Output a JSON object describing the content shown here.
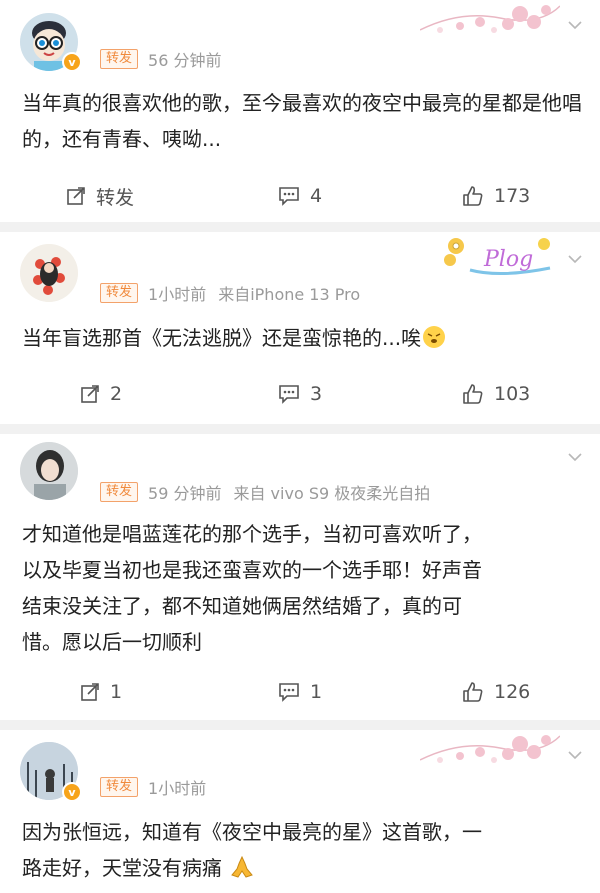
{
  "comments": [
    {
      "badge": "转发",
      "time": "56 分钟前",
      "source": "",
      "text": "当年真的很喜欢他的歌，至今最喜欢的夜空中最亮的星都是他唱的，还有青春、咦呦...",
      "actions": {
        "repost": "转发",
        "comment": "4",
        "like": "173"
      }
    },
    {
      "badge": "转发",
      "time": "1小时前",
      "source": "来自iPhone 13 Pro",
      "text": "当年盲选那首《无法逃脱》还是蛮惊艳的...唉",
      "emoji": "tired-face-emoji",
      "actions": {
        "repost": "2",
        "comment": "3",
        "like": "103"
      }
    },
    {
      "badge": "转发",
      "time": "59 分钟前",
      "source": "来自 vivo S9 极夜柔光自拍",
      "text_lines": [
        "才知道他是唱蓝莲花的那个选手，当初可喜欢听了，",
        "以及毕夏当初也是我还蛮喜欢的一个选手耶！好声音",
        "结束没关注了，都不知道她俩居然结婚了，真的可",
        "惜。愿以后一切顺利"
      ],
      "actions": {
        "repost": "1",
        "comment": "1",
        "like": "126"
      }
    },
    {
      "badge": "转发",
      "time": "1小时前",
      "source": "",
      "text_lines": [
        "因为张恒远，知道有《夜空中最亮的星》这首歌，一",
        "路走好，天堂没有病痛"
      ],
      "emoji": "praying-hands-emoji"
    }
  ],
  "deco_text": "Plog",
  "verified_mark": "v",
  "colors": {
    "badge_border": "#f3a26a",
    "badge_text": "#f08a3d",
    "separator": "#f1f1f1",
    "verified": "#f7a41b"
  }
}
